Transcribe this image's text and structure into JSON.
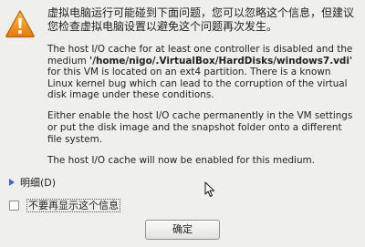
{
  "dialog": {
    "headline": "虚拟电脑运行可能碰到下面问题，您可以忽略这个信息，但建议您检查虚拟电脑设置以避免这个问题再次发生。",
    "paragraph1_pre": "The host I/O cache for at least one controller is disabled and the medium ",
    "path": "'/home/nigo/.VirtualBox/HardDisks/windows7.vdi'",
    "paragraph1_post": " for this VM is located on an ext4 partition. There is a known Linux kernel bug which can lead to the corruption of the virtual disk image under these conditions.",
    "paragraph2": "Either enable the host I/O cache permanently in the VM settings or put the disk image and the snapshot folder onto a different file system.",
    "paragraph3": "The host I/O cache will now be enabled for this medium.",
    "details_label": "明细(D)",
    "dont_show_label": "不要再显示这个信息",
    "dont_show_checked": false,
    "ok_label": "确定"
  },
  "icons": {
    "warning": "warning-triangle-icon",
    "expander": "expander-triangle-icon",
    "cursor": "mouse-pointer-icon"
  },
  "colors": {
    "warning_fill": "#f29a19",
    "background": "#efefed",
    "expander": "#3d6bb5"
  }
}
